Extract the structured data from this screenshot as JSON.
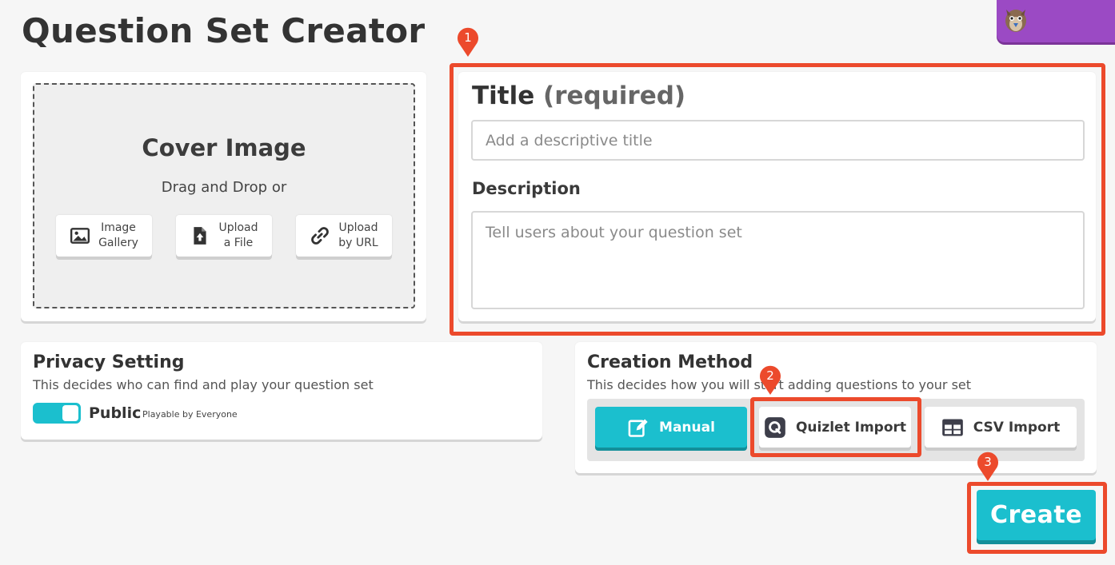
{
  "page": {
    "title": "Question Set Creator"
  },
  "cover": {
    "title": "Cover Image",
    "subtitle": "Drag and Drop or",
    "buttons": [
      {
        "label": "Image\nGallery",
        "icon": "image-icon"
      },
      {
        "label": "Upload\na File",
        "icon": "file-upload-icon"
      },
      {
        "label": "Upload\nby URL",
        "icon": "link-icon"
      }
    ]
  },
  "form": {
    "title_label": "Title",
    "title_required": "(required)",
    "title_placeholder": "Add a descriptive title",
    "title_value": "",
    "description_label": "Description",
    "description_placeholder": "Tell users about your question set",
    "description_value": ""
  },
  "privacy": {
    "heading": "Privacy Setting",
    "description": "This decides who can find and play your question set",
    "toggle_on": true,
    "label": "Public",
    "sublabel": "Playable by Everyone"
  },
  "creation": {
    "heading": "Creation Method",
    "description": "This decides how you will start adding questions to your set",
    "methods": [
      {
        "label": "Manual",
        "icon": "edit-icon",
        "selected": true
      },
      {
        "label": "Quizlet Import",
        "icon": "quizlet-icon",
        "selected": false
      },
      {
        "label": "CSV Import",
        "icon": "table-icon",
        "selected": false
      }
    ]
  },
  "create_button": {
    "label": "Create"
  },
  "annotations": [
    "1",
    "2",
    "3"
  ],
  "colors": {
    "accent": "#1bbfce",
    "accent_shadow": "#138f9a",
    "annotation": "#ec4a2c",
    "profile": "#9b4ac4"
  }
}
